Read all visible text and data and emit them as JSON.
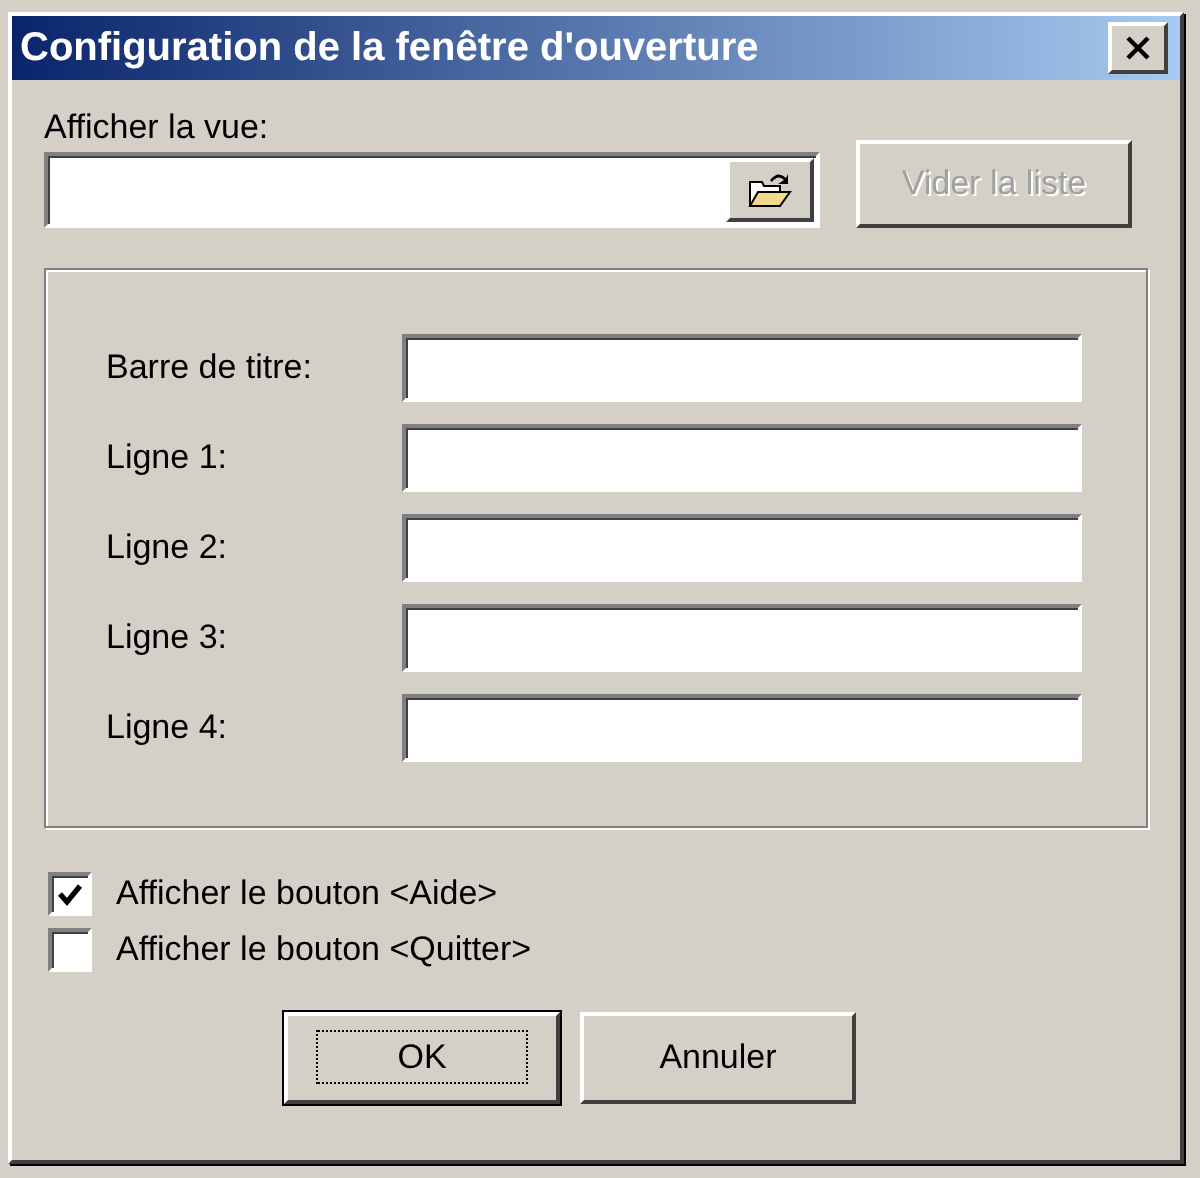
{
  "window": {
    "title": "Configuration de la fenêtre d'ouverture"
  },
  "view": {
    "label": "Afficher la vue:"
  },
  "clear_button": {
    "label": "Vider la liste",
    "disabled": true
  },
  "fields": [
    {
      "label": "Barre de titre:"
    },
    {
      "label": "Ligne 1:"
    },
    {
      "label": "Ligne 2:"
    },
    {
      "label": "Ligne 3:"
    },
    {
      "label": "Ligne 4:"
    }
  ],
  "checkboxes": [
    {
      "label": "Afficher le bouton <Aide>",
      "checked": true
    },
    {
      "label": "Afficher le bouton <Quitter>",
      "checked": false
    }
  ],
  "buttons": [
    {
      "label": "OK",
      "default": true
    },
    {
      "label": "Annuler",
      "default": false
    }
  ]
}
